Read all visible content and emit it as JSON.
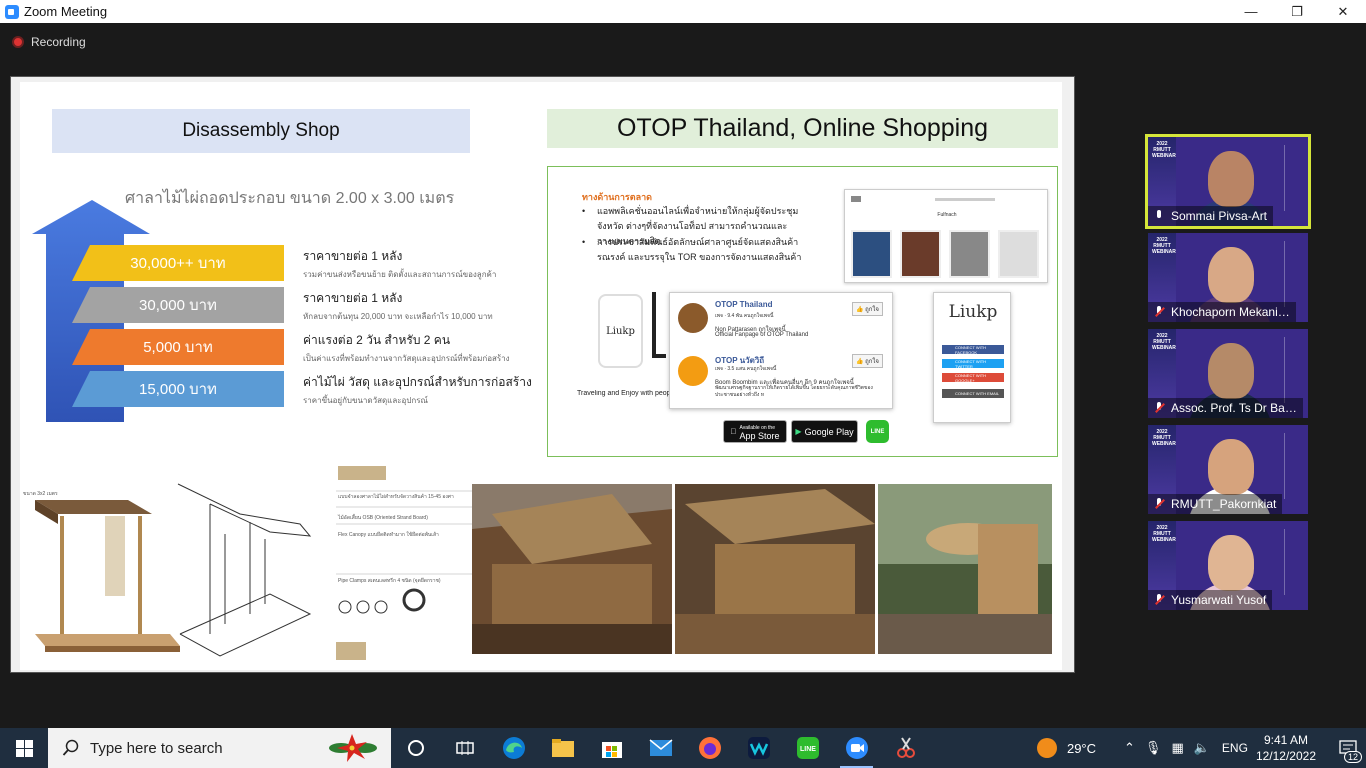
{
  "window": {
    "title": "Zoom Meeting",
    "controls": {
      "minimize": "—",
      "maximize": "❐",
      "close": "✕"
    }
  },
  "recording": {
    "label": "Recording"
  },
  "slide": {
    "left_header": "Disassembly Shop",
    "right_header": "OTOP Thailand, Online Shopping",
    "sala_title": "ศาลาไม้ไผ่ถอดประกอบ ขนาด 2.00 x 3.00 เมตร",
    "prices": [
      {
        "value": "30,000++ บาท",
        "color": "#f2c018",
        "title": "ราคาขายต่อ 1 หลัง",
        "desc": "รวมค่าขนส่งหรือขนย้าย ติดตั้งและสถานการณ์ของลูกค้า"
      },
      {
        "value": "30,000 บาท",
        "color": "#a3a3a3",
        "title": "ราคาขายต่อ 1 หลัง",
        "desc": "หักลบจากต้นทุน 20,000 บาท จะเหลือกำไร 10,000 บาท"
      },
      {
        "value": "5,000 บาท",
        "color": "#ee7a2d",
        "title": "ค่าแรงต่อ 2 วัน สำหรับ 2 คน",
        "desc": "เป็นค่าแรงที่พร้อมทำงานจากวัสดุและอุปกรณ์ที่พร้อมก่อสร้าง"
      },
      {
        "value": "15,000 บาท",
        "color": "#5b9bd5",
        "title": "ค่าไม้ไผ่ วัสดุ และอุปกรณ์สำหรับการก่อสร้าง",
        "desc": "ราคาขึ้นอยู่กับขนาดวัสดุและอุปกรณ์"
      }
    ],
    "marketing": {
      "title": "ทางด้านการตลาด",
      "bullets": [
        "แอพพลิเคชั่นออนไลน์เพื่อจำหน่ายให้กลุ่มผู้จัดประชุม จังหวัด ต่างๆที่จัดงานโอท็อป สามารถคำนวณและวางแผนการผลิต",
        "การประชาสัมพันธ์อัตลักษณ์ศาลาศูนย์จัดแสดงสินค้ารณรงค์ และบรรจุใน TOR ของการจัดงานแสดงสินค้า"
      ],
      "web_title": "Fulfnach",
      "liukp_logo": "Liukp",
      "phone_logo": "Liukp",
      "travel_text": "Traveling and Enjoy with peop",
      "fb_pages": [
        {
          "name": "OTOP Thailand",
          "meta": "เพจ · 9.4 พัน คนถูกใจเพจนี้",
          "desc1": "Non Pattarasen ถูกใจเพจนี้",
          "desc2": "Official Fanpage of OTOP Thailand",
          "like": "👍 ถูกใจ",
          "color": "#8b5a2b"
        },
        {
          "name": "OTOP นวัตวิถี",
          "meta": "เพจ · 3.5 แสน คนถูกใจเพจนี้",
          "desc1": "Boom Boombim และเพื่อนคนอื่นๆ อีก 9 คนถูกใจเพจนี้",
          "desc2": "พัฒนาเศรษฐกิจฐานรากให้เกิดรายได้เพิ่มขึ้น โดยยกระดับคุณภาพชีวิตของประชาชนอย่างทั่วถึง ห",
          "like": "👍 ถูกใจ",
          "color": "#f39c12"
        }
      ],
      "social_buttons": [
        {
          "label": "CONNECT WITH FACEBOOK",
          "color": "#3b5998"
        },
        {
          "label": "CONNECT WITH TWITTER",
          "color": "#1da1f2"
        },
        {
          "label": "CONNECT WITH GOOGLE+",
          "color": "#dd4b39"
        },
        {
          "label": "CONNECT WITH EMAIL",
          "color": "#555555"
        }
      ],
      "app_store": {
        "small": "Available on the",
        "big": "App Store"
      },
      "google_play": {
        "big": "Google Play"
      },
      "line_label": "LINE"
    },
    "drawing_labels": {
      "size": "ขนาด 3x2 เมตร",
      "a": "แบบจำลองศาลาไม้ไผ่สำหรับจัดวางสินค้า 15-45 องศา",
      "b": "ไม้อัดเสี้ยน OSB (Oriented Strand Board)",
      "c": "Flex Canopy แบบยึดติดทำมาก ใช้ยึดต่อพ้นเส้า",
      "d": "Pipe Clamps สเตนเลสทรีก 4 ชนิด (จุดยึดกราช)"
    }
  },
  "participants": [
    {
      "name": "Sommai Pivsa-Art",
      "muted": false,
      "active": true,
      "shirt": "#2b3a7a",
      "face": "#b98465"
    },
    {
      "name": "Khochaporn Mekani…",
      "muted": true,
      "active": false,
      "shirt": "#5a3b7a",
      "face": "#d8a886"
    },
    {
      "name": "Assoc. Prof. Ts Dr Ba…",
      "muted": true,
      "active": false,
      "shirt": "#1c2b4a",
      "face": "#b58a68"
    },
    {
      "name": "RMUTT_Pakornkiat",
      "muted": true,
      "active": false,
      "shirt": "#ffffff",
      "face": "#d6a37d"
    },
    {
      "name": "Yusmarwati Yusof",
      "muted": true,
      "active": false,
      "shirt": "#e8c6d6",
      "face": "#e0b593"
    }
  ],
  "participant_badge": {
    "line1": "2022",
    "line2": "RMUTT",
    "line3": "WEBINAR"
  },
  "taskbar": {
    "search_placeholder": "Type here to search",
    "weather": "29°C",
    "lang": "ENG",
    "time": "9:41 AM",
    "date": "12/12/2022",
    "notifications": "12"
  }
}
